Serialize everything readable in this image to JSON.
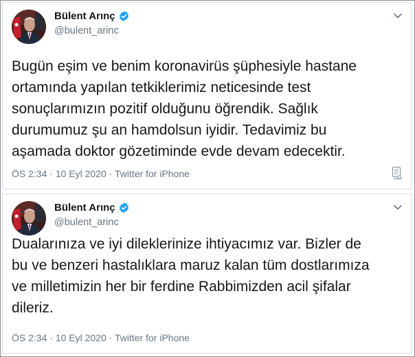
{
  "tweets": [
    {
      "display_name": "Bülent Arınç",
      "handle": "@bulent_arinc",
      "text": "Bugün eşim ve benim koronavirüs şüphesiyle hastane\nortamında yapılan tetkiklerimiz neticesinde test\nsonuçlarımızın pozitif olduğunu öğrendik. Sağlık\ndurumumuz şu an hamdolsun iyidir. Tedavimiz bu\naşamada doktor gözetiminde evde devam edecektir.",
      "time": "ÖS 2:34",
      "date": "10 Eyl 2020",
      "source": "Twitter for iPhone",
      "separator": " · "
    },
    {
      "display_name": "Bülent Arınç",
      "handle": "@bulent_arinc",
      "text": "Dualarınıza ve iyi dileklerinize ihtiyacımız var. Bizler de\nbu ve benzeri hastalıklara maruz kalan tüm dostlarımıza\nve milletimizin her bir ferdine Rabbimizden acil şifalar\ndileriz.",
      "time": "ÖS 2:34",
      "date": "10 Eyl 2020",
      "source": "Twitter for iPhone",
      "separator": " · "
    }
  ],
  "icons": {
    "verified": "verified-badge-icon",
    "caret": "chevron-down-icon",
    "analytics": "tweet-analytics-icon"
  },
  "colors": {
    "text": "#14171a",
    "secondary": "#657786",
    "verified": "#1da1f2",
    "border": "#d9dde1"
  }
}
